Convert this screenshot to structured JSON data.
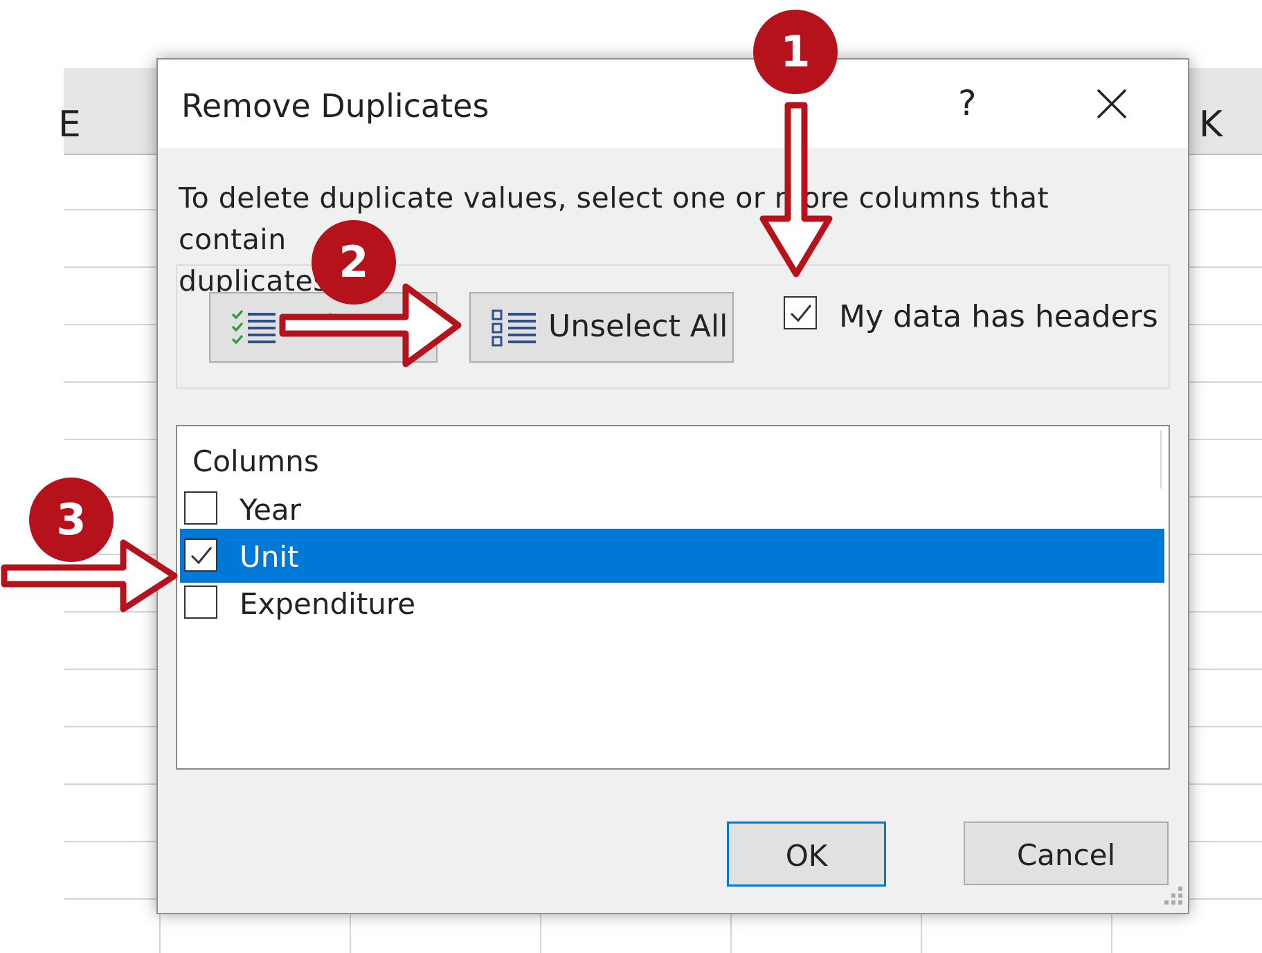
{
  "sheet": {
    "column_letters": [
      "E",
      "K"
    ]
  },
  "dialog": {
    "title": "Remove Duplicates",
    "help_label": "?",
    "instruction_line1": "To delete duplicate values, select one or more columns that contain",
    "instruction_line2": "duplicates.",
    "select_all_label": "Select All",
    "unselect_all_label": "Unselect All",
    "headers_checkbox": {
      "label": "My data has headers",
      "checked": true
    },
    "columns_header": "Columns",
    "columns": [
      {
        "label": "Year",
        "checked": false,
        "selected": false
      },
      {
        "label": "Unit",
        "checked": true,
        "selected": true
      },
      {
        "label": "Expenditure",
        "checked": false,
        "selected": false
      }
    ],
    "ok_label": "OK",
    "cancel_label": "Cancel"
  },
  "annotations": {
    "badge_1": "1",
    "badge_2": "2",
    "badge_3": "3",
    "color": "#b5121b"
  },
  "colors": {
    "selection": "#0078d7",
    "dialog_bg": "#f0f0f0",
    "button_bg": "#e1e1e1"
  }
}
